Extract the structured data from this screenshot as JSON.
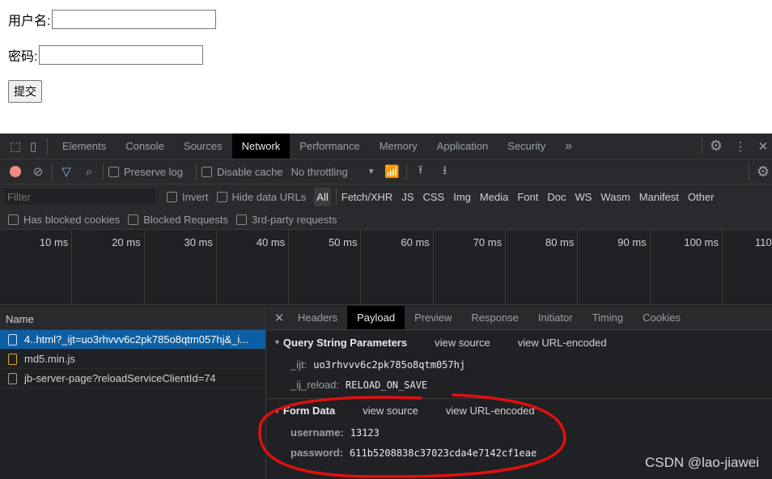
{
  "form": {
    "username_label": "用户名:",
    "password_label": "密码:",
    "submit": "提交"
  },
  "devtools": {
    "tabs": [
      "Elements",
      "Console",
      "Sources",
      "Network",
      "Performance",
      "Memory",
      "Application",
      "Security"
    ],
    "active_tab": "Network",
    "more": "»",
    "toolbar": {
      "preserve_log": "Preserve log",
      "disable_cache": "Disable cache",
      "throttling": "No throttling"
    },
    "filter": {
      "placeholder": "Filter",
      "invert": "Invert",
      "hide_data_urls": "Hide data URLs",
      "types": [
        "All",
        "Fetch/XHR",
        "JS",
        "CSS",
        "Img",
        "Media",
        "Font",
        "Doc",
        "WS",
        "Wasm",
        "Manifest",
        "Other"
      ]
    },
    "checks": [
      "Has blocked cookies",
      "Blocked Requests",
      "3rd-party requests"
    ],
    "timeline_ticks": [
      "10 ms",
      "20 ms",
      "30 ms",
      "40 ms",
      "50 ms",
      "60 ms",
      "70 ms",
      "80 ms",
      "90 ms",
      "100 ms",
      "110"
    ],
    "names": {
      "header": "Name",
      "rows": [
        {
          "name": "4..html?_ijt=uo3rhvvv6c2pk785o8qtm057hj&_i...",
          "icon": "document-icon"
        },
        {
          "name": "md5.min.js",
          "icon": "script-icon"
        },
        {
          "name": "jb-server-page?reloadServiceClientId=74",
          "icon": "file-icon"
        }
      ]
    },
    "detail_tabs": [
      "Headers",
      "Payload",
      "Preview",
      "Response",
      "Initiator",
      "Timing",
      "Cookies"
    ],
    "active_detail_tab": "Payload",
    "query": {
      "title": "Query String Parameters",
      "view_source": "view source",
      "view_url": "view URL-encoded",
      "params": [
        {
          "k": "_ijt:",
          "v": "uo3rhvvv6c2pk785o8qtm057hj"
        },
        {
          "k": "_ij_reload:",
          "v": "RELOAD_ON_SAVE"
        }
      ]
    },
    "formdata": {
      "title": "Form Data",
      "view_source": "view source",
      "view_url": "view URL-encoded",
      "params": [
        {
          "k": "username:",
          "v": "13123"
        },
        {
          "k": "password:",
          "v": "611b5208838c37023cda4e7142cf1eae"
        }
      ]
    }
  },
  "watermark": "CSDN @lao-jiawei",
  "colors": {
    "annotation": "#e01010",
    "selected": "#0d5fa3",
    "record": "#f28b82",
    "filter_active": "#8ab4f8"
  }
}
